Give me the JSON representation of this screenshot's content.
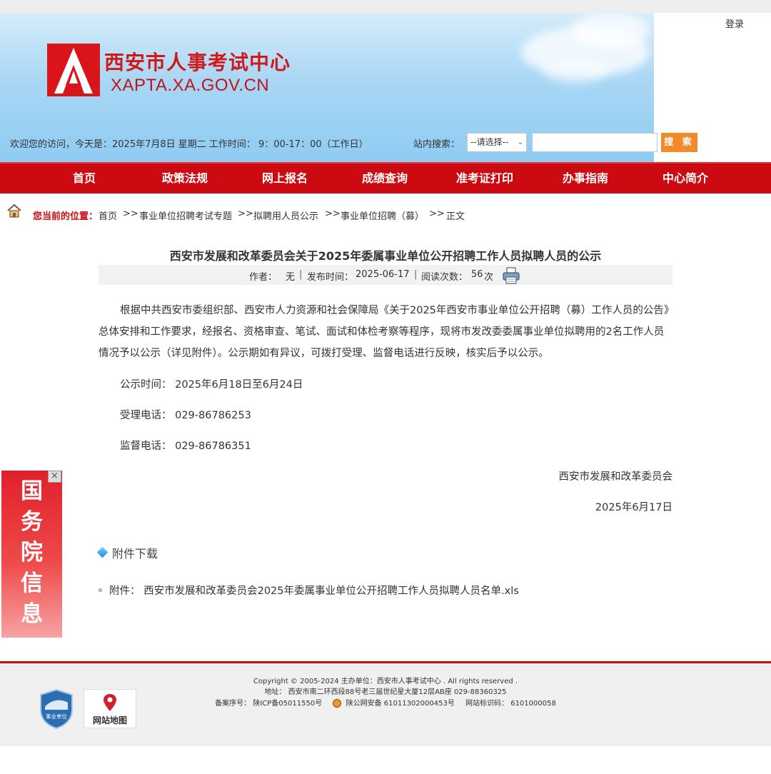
{
  "header": {
    "login": "登录",
    "site_name": "西安市人事考试中心",
    "site_domain": "XAPTA.XA.GOV.CN",
    "welcome": "欢迎您的访问，今天是：2025年7月8日 星期二  工作时间：  9：00-17：00（工作日）",
    "search_label": "站内搜索：",
    "search_select": "--请选择--",
    "search_button": "搜 索"
  },
  "nav": [
    "首页",
    "政策法规",
    "网上报名",
    "成绩查询",
    "准考证打印",
    "办事指南",
    "中心简介"
  ],
  "breadcrumb": {
    "label": "您当前的位置：",
    "items": [
      "首页",
      "事业单位招聘考试专题",
      "拟聘用人员公示",
      "事业单位招聘（募）",
      "正文"
    ],
    "separator": ">>"
  },
  "article": {
    "title": "西安市发展和改革委员会关于2025年委属事业单位公开招聘工作人员拟聘人员的公示",
    "author_label": "作者：",
    "author": "无",
    "date_label": "发布时间：",
    "date": "2025-06-17",
    "reads_label": "阅读次数：",
    "reads": "56",
    "reads_unit": "次",
    "paragraph": "根据中共西安市委组织部、西安市人力资源和社会保障局《关于2025年西安市事业单位公开招聘（募）工作人员的公告》总体安排和工作要求，经报名、资格审查、笔试、面试和体检考察等程序，现将市发改委委属事业单位拟聘用的2名工作人员情况予以公示（详见附件）。公示期如有异议，可拨打受理、监督电话进行反映，核实后予以公示。",
    "notice_time": "公示时间：  2025年6月18日至6月24日",
    "accept_phone": "受理电话：  029-86786253",
    "supervise_phone": "监督电话：  029-86786351",
    "signer": "西安市发展和改革委员会",
    "sign_date": "2025年6月17日"
  },
  "attachments": {
    "heading": "附件下载",
    "item": "附件：  西安市发展和改革委员会2025年委属事业单位公开招聘工作人员拟聘人员名单.xls"
  },
  "float_ad": {
    "chars": [
      "国",
      "务",
      "院",
      "信",
      "息"
    ],
    "close": "×"
  },
  "footer": {
    "copyright": "Copyright © 2005-2024 主办单位：西安市人事考试中心 . All rights reserved .",
    "address": "地址：  西安市南二环西段88号老三届世纪星大厦12层AB座   029-88360325",
    "icp": "备案序号：  陕ICP备05011550号",
    "police": "陕公网安备 61011302000453号",
    "site_id": "网站标识码：  6101000058",
    "shield_text": "事业单位",
    "sitemap": "网站地图"
  }
}
